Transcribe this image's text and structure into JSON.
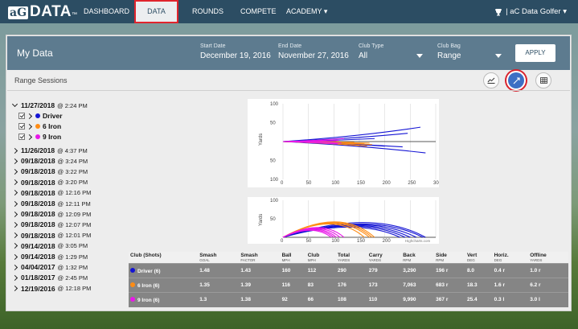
{
  "nav": {
    "logo_ag": "aG",
    "logo_data": "DATA",
    "logo_tm": "™",
    "items": [
      "DASHBOARD",
      "DATA",
      "ROUNDS",
      "COMPETE",
      "ACADEMY ▾"
    ],
    "user": "| aC Data Golfer ▾"
  },
  "header": {
    "title": "My Data",
    "start_label": "Start Date",
    "start_value": "December 19, 2016",
    "end_label": "End Date",
    "end_value": "November 27, 2016",
    "clubtype_label": "Club Type",
    "clubtype_value": "All",
    "clubbag_label": "Club Bag",
    "clubbag_value": "Range",
    "apply": "APPLY"
  },
  "range_sessions_title": "Range Sessions",
  "sessions": [
    {
      "date": "11/27/2018",
      "time": "@ 2:24 PM",
      "expanded": true
    },
    {
      "date": "11/26/2018",
      "time": "@ 4:37 PM"
    },
    {
      "date": "09/18/2018",
      "time": "@ 3:24 PM"
    },
    {
      "date": "09/18/2018",
      "time": "@ 3:22 PM"
    },
    {
      "date": "09/18/2018",
      "time": "@ 3:20 PM"
    },
    {
      "date": "09/18/2018",
      "time": "@ 12:16 PM"
    },
    {
      "date": "09/18/2018",
      "time": "@ 12:11 PM"
    },
    {
      "date": "09/18/2018",
      "time": "@ 12:09 PM"
    },
    {
      "date": "09/18/2018",
      "time": "@ 12:07 PM"
    },
    {
      "date": "09/18/2018",
      "time": "@ 12:01 PM"
    },
    {
      "date": "09/14/2018",
      "time": "@ 3:05 PM"
    },
    {
      "date": "09/14/2018",
      "time": "@ 1:29 PM"
    },
    {
      "date": "04/04/2017",
      "time": "@ 1:32 PM"
    },
    {
      "date": "01/18/2017",
      "time": "@ 2:45 PM"
    },
    {
      "date": "12/19/2016",
      "time": "@ 12:18 PM"
    }
  ],
  "clubs": [
    {
      "label": "Driver",
      "color": "#1414d4"
    },
    {
      "label": "6 Iron",
      "color": "#ff8c14"
    },
    {
      "label": "9 Iron",
      "color": "#e818e8"
    }
  ],
  "colors": {
    "driver": "#1414d4",
    "iron6": "#ff8c14",
    "iron9": "#e818e8",
    "header": "#5d7b8f",
    "nav": "#2c4d63"
  },
  "chart_data": [
    {
      "type": "line",
      "title": "",
      "ylabel": "Yards",
      "x_ticks": [
        "0",
        "50",
        "100",
        "150",
        "200",
        "250",
        "300"
      ],
      "y_ticks_top": [
        "100",
        "50"
      ],
      "y_ticks_bottom": [
        "50",
        "100"
      ],
      "xlim": [
        0,
        300
      ],
      "ylim": [
        -100,
        100
      ],
      "series": [
        {
          "name": "Driver (6)",
          "color": "#1414d4",
          "lines": [
            [
              [
                0,
                0
              ],
              [
                270,
                38
              ]
            ],
            [
              [
                0,
                0
              ],
              [
                245,
                22
              ]
            ],
            [
              [
                0,
                0
              ],
              [
                280,
                -30
              ]
            ],
            [
              [
                0,
                0
              ],
              [
                235,
                -14
              ]
            ],
            [
              [
                0,
                0
              ],
              [
                200,
                -12
              ]
            ],
            [
              [
                0,
                0
              ],
              [
                180,
                8
              ]
            ]
          ]
        },
        {
          "name": "6 Iron (6)",
          "color": "#ff8c14",
          "lines": [
            [
              [
                0,
                0
              ],
              [
                175,
                -8
              ]
            ],
            [
              [
                0,
                0
              ],
              [
                170,
                -4
              ]
            ],
            [
              [
                0,
                0
              ],
              [
                165,
                -12
              ]
            ],
            [
              [
                0,
                0
              ],
              [
                160,
                -6
              ]
            ],
            [
              [
                0,
                0
              ],
              [
                150,
                -10
              ]
            ],
            [
              [
                0,
                0
              ],
              [
                140,
                -2
              ]
            ]
          ]
        },
        {
          "name": "9 Iron (6)",
          "color": "#e818e8",
          "lines": [
            [
              [
                0,
                0
              ],
              [
                120,
                8
              ]
            ],
            [
              [
                0,
                0
              ],
              [
                115,
                -4
              ]
            ],
            [
              [
                0,
                0
              ],
              [
                110,
                3
              ]
            ],
            [
              [
                0,
                0
              ],
              [
                108,
                -6
              ]
            ],
            [
              [
                0,
                0
              ],
              [
                105,
                2
              ]
            ],
            [
              [
                0,
                0
              ],
              [
                100,
                -3
              ]
            ]
          ]
        }
      ]
    },
    {
      "type": "line",
      "title": "",
      "ylabel": "Yards",
      "x_ticks": [
        "0",
        "50",
        "100",
        "150",
        "200"
      ],
      "y_ticks": [
        "100",
        "50"
      ],
      "xlim": [
        0,
        300
      ],
      "ylim": [
        0,
        100
      ],
      "credit": "Highcharts.com",
      "series": [
        {
          "name": "Driver (6)",
          "color": "#1414d4",
          "arcs": [
            [
              0,
              280,
              42
            ],
            [
              0,
              275,
              38
            ],
            [
              0,
              262,
              36
            ],
            [
              0,
              250,
              34
            ],
            [
              0,
              240,
              32
            ],
            [
              0,
              230,
              29
            ]
          ]
        },
        {
          "name": "6 Iron (6)",
          "color": "#ff8c14",
          "arcs": [
            [
              0,
              180,
              44
            ],
            [
              0,
              175,
              42
            ],
            [
              0,
              170,
              40
            ],
            [
              0,
              160,
              38
            ]
          ]
        },
        {
          "name": "9 Iron (6)",
          "color": "#e818e8",
          "arcs": [
            [
              0,
              120,
              28
            ],
            [
              0,
              112,
              26
            ],
            [
              0,
              105,
              24
            ],
            [
              0,
              100,
              22
            ],
            [
              0,
              95,
              20
            ]
          ]
        }
      ]
    }
  ],
  "table": {
    "headers": [
      {
        "label": "Club (Shots)",
        "unit": ""
      },
      {
        "label": "Smash",
        "unit": "GOAL"
      },
      {
        "label": "Smash",
        "unit": "FACTOR"
      },
      {
        "label": "Ball",
        "unit": "MPH"
      },
      {
        "label": "Club",
        "unit": "MPH"
      },
      {
        "label": "Total",
        "unit": "YARDS"
      },
      {
        "label": "Carry",
        "unit": "YARDS"
      },
      {
        "label": "Back",
        "unit": "RPM"
      },
      {
        "label": "Side",
        "unit": "RPM"
      },
      {
        "label": "Vert",
        "unit": "DEG"
      },
      {
        "label": "Horiz.",
        "unit": "DEG"
      },
      {
        "label": "Offline",
        "unit": "YARDS"
      }
    ],
    "rows": [
      {
        "club": "Driver (6)",
        "color": "#1414d4",
        "cells": [
          "1.48",
          "1.43",
          "160",
          "112",
          "290",
          "279",
          "3,290",
          "196 r",
          "8.0",
          "0.4 r",
          "1.0 r"
        ]
      },
      {
        "club": "6 Iron (6)",
        "color": "#ff8c14",
        "cells": [
          "1.35",
          "1.39",
          "116",
          "83",
          "176",
          "173",
          "7,063",
          "683 r",
          "18.3",
          "1.6 r",
          "6.2 r"
        ]
      },
      {
        "club": "9 Iron (6)",
        "color": "#e818e8",
        "cells": [
          "1.3",
          "1.38",
          "92",
          "66",
          "108",
          "110",
          "9,990",
          "367 r",
          "25.4",
          "0.3 l",
          "3.0 l"
        ]
      }
    ]
  }
}
